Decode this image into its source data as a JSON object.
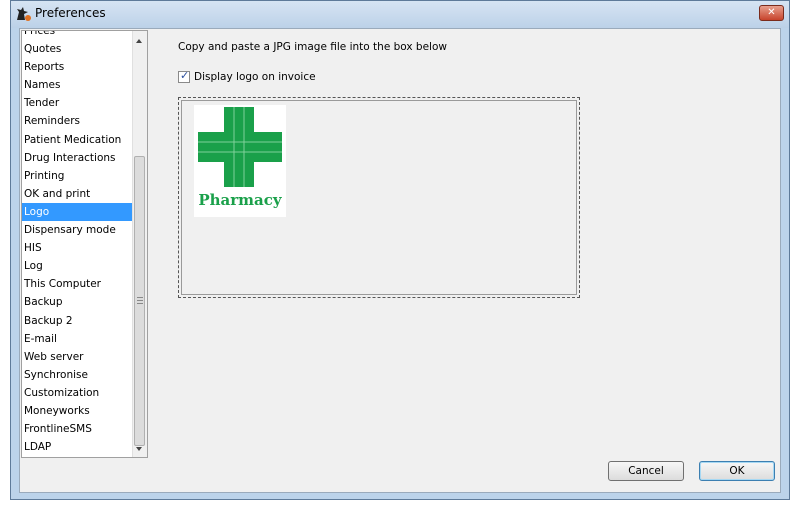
{
  "window": {
    "title": "Preferences"
  },
  "sidebar": {
    "items": [
      {
        "label": "Prices",
        "selected": false
      },
      {
        "label": "Quotes",
        "selected": false
      },
      {
        "label": "Reports",
        "selected": false
      },
      {
        "label": "Names",
        "selected": false
      },
      {
        "label": "Tender",
        "selected": false
      },
      {
        "label": "Reminders",
        "selected": false
      },
      {
        "label": "Patient Medication",
        "selected": false
      },
      {
        "label": "Drug Interactions",
        "selected": false
      },
      {
        "label": "Printing",
        "selected": false
      },
      {
        "label": "OK and print",
        "selected": false
      },
      {
        "label": "Logo",
        "selected": true
      },
      {
        "label": "Dispensary mode",
        "selected": false
      },
      {
        "label": "HIS",
        "selected": false
      },
      {
        "label": "Log",
        "selected": false
      },
      {
        "label": "This Computer",
        "selected": false
      },
      {
        "label": "Backup",
        "selected": false
      },
      {
        "label": "Backup 2",
        "selected": false
      },
      {
        "label": "E-mail",
        "selected": false
      },
      {
        "label": "Web server",
        "selected": false
      },
      {
        "label": "Synchronise",
        "selected": false
      },
      {
        "label": "Customization",
        "selected": false
      },
      {
        "label": "Moneyworks",
        "selected": false
      },
      {
        "label": "FrontlineSMS",
        "selected": false
      },
      {
        "label": "LDAP",
        "selected": false
      }
    ]
  },
  "main": {
    "instruction": "Copy and paste a JPG image file into the box below",
    "display_logo_label": "Display logo on invoice",
    "display_logo_checked": true,
    "logo_text": "Pharmacy"
  },
  "buttons": {
    "cancel": "Cancel",
    "ok": "OK"
  },
  "colors": {
    "selection": "#3399ff",
    "logo_green": "#1aa04a"
  }
}
